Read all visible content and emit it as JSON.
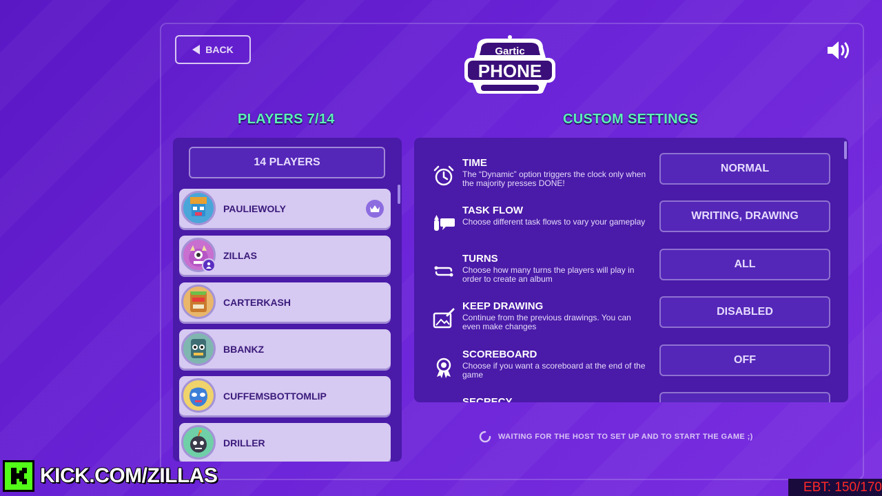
{
  "header": {
    "back_label": "BACK",
    "logo_top": "Gartic",
    "logo_main": "PHONE"
  },
  "players": {
    "title": "PLAYERS 7/14",
    "count_label": "14 PLAYERS",
    "list": [
      {
        "name": "PAULIEWOLY",
        "host": true
      },
      {
        "name": "ZILLAS",
        "you": true
      },
      {
        "name": "CARTERKASH"
      },
      {
        "name": "BBANKZ"
      },
      {
        "name": "CUFFEMSBOTTOMLIP"
      },
      {
        "name": "DRILLER"
      }
    ]
  },
  "settings": {
    "title": "CUSTOM SETTINGS",
    "items": [
      {
        "title": "TIME",
        "desc": "The “Dynamic” option triggers the clock only when the majority presses DONE!",
        "value": "NORMAL",
        "icon": "alarm-clock-icon"
      },
      {
        "title": "TASK FLOW",
        "desc": "Choose different task flows to vary your gameplay",
        "value": "WRITING, DRAWING",
        "icon": "pencil-bubble-icon"
      },
      {
        "title": "TURNS",
        "desc": "Choose how many turns the players will play in order to create an album",
        "value": "ALL",
        "icon": "turns-icon"
      },
      {
        "title": "KEEP DRAWING",
        "desc": "Continue from the previous drawings. You can even make changes",
        "value": "DISABLED",
        "icon": "keep-drawing-icon"
      },
      {
        "title": "SCOREBOARD",
        "desc": "Choose if you want a scoreboard at the end of the game",
        "value": "OFF",
        "icon": "medal-icon"
      },
      {
        "title": "SECRECY",
        "desc": "",
        "value": "",
        "icon": ""
      }
    ]
  },
  "status": {
    "waiting": "WAITING FOR THE HOST TO SET UP AND TO START THE GAME ;)"
  },
  "overlay": {
    "kick_url": "KICK.COM/ZILLAS",
    "ebt": "EBT: 150/170"
  },
  "colors": {
    "accent_green": "#5cf0b8",
    "panel": "#4a1aa8",
    "player_card": "#d6c9f2",
    "kick_green": "#53fc18",
    "ebt_red": "#ff2828"
  }
}
